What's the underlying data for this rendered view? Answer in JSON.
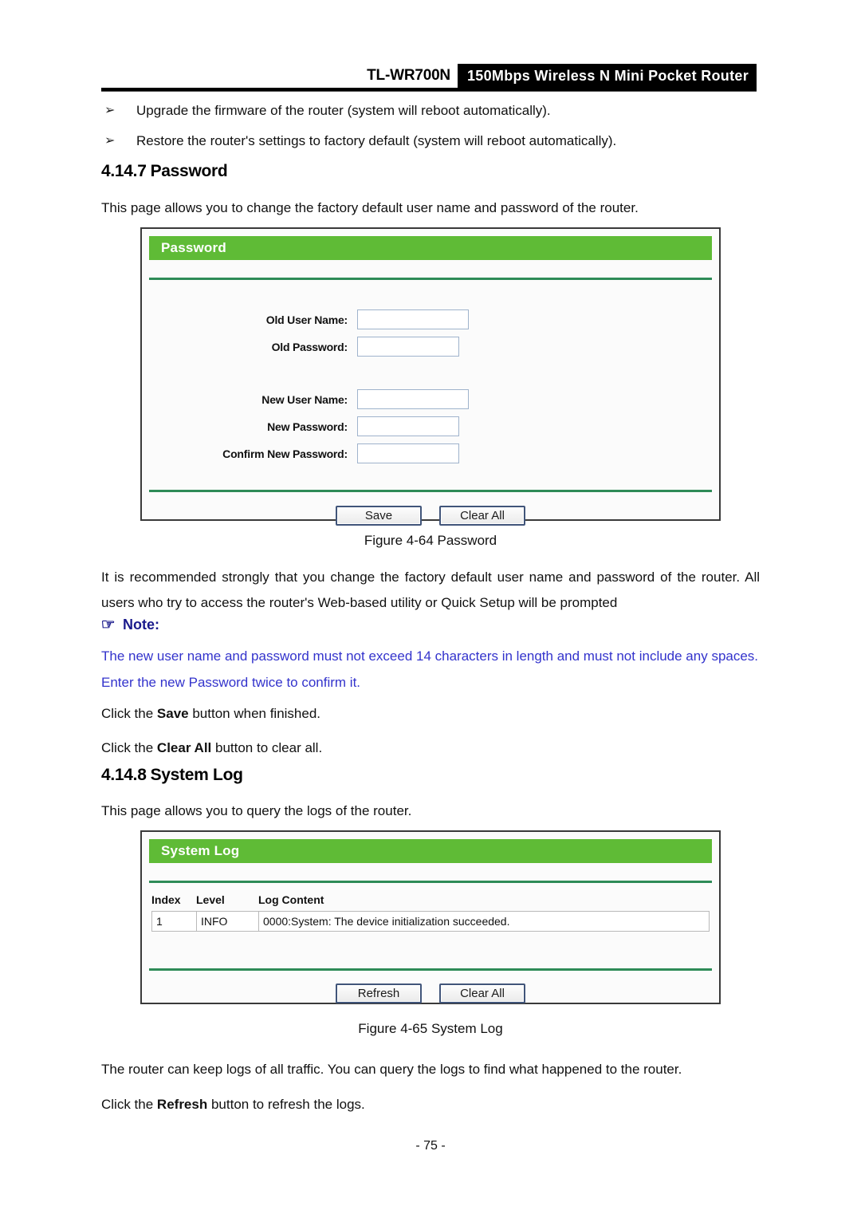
{
  "header": {
    "model": "TL-WR700N",
    "tagline": "150Mbps Wireless N Mini Pocket Router"
  },
  "bullets": [
    {
      "marker": "➢",
      "text": "Upgrade the firmware of the router (system will reboot automatically)."
    },
    {
      "marker": "➢",
      "text": "Restore the router's settings to factory default (system will reboot automatically)."
    }
  ],
  "section_password": {
    "number": "4.14.7",
    "title": "Password",
    "intro": "This page allows you to change the factory default user name and password of the router.",
    "caption": "Figure 4-64 Password",
    "body": "It is recommended strongly that you change the factory default user name and password of the router. All users who try to access the router's Web-based utility or Quick Setup will be prompted",
    "note_label": "Note:",
    "note_glyph": "☞",
    "note_text": "The new user name and password must not exceed 14 characters in length and must not include any spaces. Enter the new Password twice to confirm it.",
    "click_save_pre": "Click the ",
    "click_save_bold": "Save",
    "click_save_post": " button when finished.",
    "click_clear_pre": "Click the ",
    "click_clear_bold": "Clear All",
    "click_clear_post": " button to clear all."
  },
  "password_panel": {
    "title": "Password",
    "fields": [
      {
        "label": "Old User Name:",
        "value": "",
        "size": "wide"
      },
      {
        "label": "Old Password:",
        "value": "",
        "size": "short"
      },
      {
        "label": "New User Name:",
        "value": "",
        "size": "wide"
      },
      {
        "label": "New Password:",
        "value": "",
        "size": "short"
      },
      {
        "label": "Confirm New Password:",
        "value": "",
        "size": "short"
      }
    ],
    "buttons": [
      {
        "label": "Save"
      },
      {
        "label": "Clear All"
      }
    ]
  },
  "section_syslog": {
    "number": "4.14.8",
    "title": "System Log",
    "intro": "This page allows you to query the logs of the router.",
    "caption": "Figure 4-65 System Log",
    "body": "The router can keep logs of all traffic. You can query the logs to find what happened to the router.",
    "click_refresh_pre": "Click the ",
    "click_refresh_bold": "Refresh",
    "click_refresh_post": " button to refresh the logs."
  },
  "syslog_panel": {
    "title": "System Log",
    "columns": [
      "Index",
      "Level",
      "Log Content"
    ],
    "rows": [
      {
        "index": "1",
        "level": "INFO",
        "content": "0000:System: The device initialization succeeded."
      }
    ],
    "buttons": [
      {
        "label": "Refresh"
      },
      {
        "label": "Clear All"
      }
    ]
  },
  "footer": {
    "page_number": "- 75 -"
  },
  "colors": {
    "panel_green": "#5fbb36",
    "divider_green": "#2e8b57",
    "note_blue": "#3333cc",
    "note_head_blue": "#1a1a8c"
  }
}
